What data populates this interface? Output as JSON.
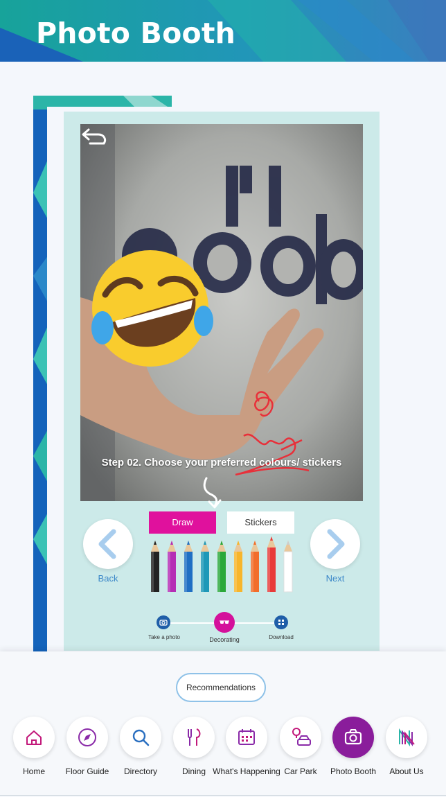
{
  "header": {
    "title": "Photo Booth"
  },
  "photo": {
    "instruction": "Step 02. Choose your preferred colours/ stickers",
    "undo_icon": "undo-icon"
  },
  "nav_buttons": {
    "back_label": "Back",
    "next_label": "Next"
  },
  "tabs": [
    {
      "label": "Draw",
      "selected": true
    },
    {
      "label": "Stickers",
      "selected": false
    }
  ],
  "pencils": [
    {
      "color": "#222222",
      "selected": false
    },
    {
      "color": "#b52db5",
      "selected": false
    },
    {
      "color": "#1f6fc4",
      "selected": false
    },
    {
      "color": "#1e98b8",
      "selected": false
    },
    {
      "color": "#2aa83a",
      "selected": false
    },
    {
      "color": "#f7b52c",
      "selected": false
    },
    {
      "color": "#f26d2b",
      "selected": false
    },
    {
      "color": "#e83a3a",
      "selected": true
    },
    {
      "color": "#ffffff",
      "selected": false
    }
  ],
  "steps": [
    {
      "label": "Take a photo",
      "icon": "camera-icon"
    },
    {
      "label": "Decorating",
      "icon": "sunglasses-icon",
      "active": true
    },
    {
      "label": "Download",
      "icon": "qr-code-icon"
    }
  ],
  "recommendations_label": "Recommendations",
  "bottom_nav": [
    {
      "label": "Home",
      "icon": "home-icon"
    },
    {
      "label": "Floor Guide",
      "icon": "compass-icon"
    },
    {
      "label": "Directory",
      "icon": "search-icon"
    },
    {
      "label": "Dining",
      "icon": "cutlery-icon"
    },
    {
      "label": "What's Happening",
      "icon": "calendar-icon"
    },
    {
      "label": "Car Park",
      "icon": "car-icon"
    },
    {
      "label": "Photo Booth",
      "icon": "camera-icon",
      "active": true
    },
    {
      "label": "About Us",
      "icon": "logo-icon"
    }
  ],
  "colors": {
    "accent": "#e0119d",
    "nav_active": "#8a1d9b",
    "link": "#3b87c8",
    "card_bg": "#cceae9"
  }
}
